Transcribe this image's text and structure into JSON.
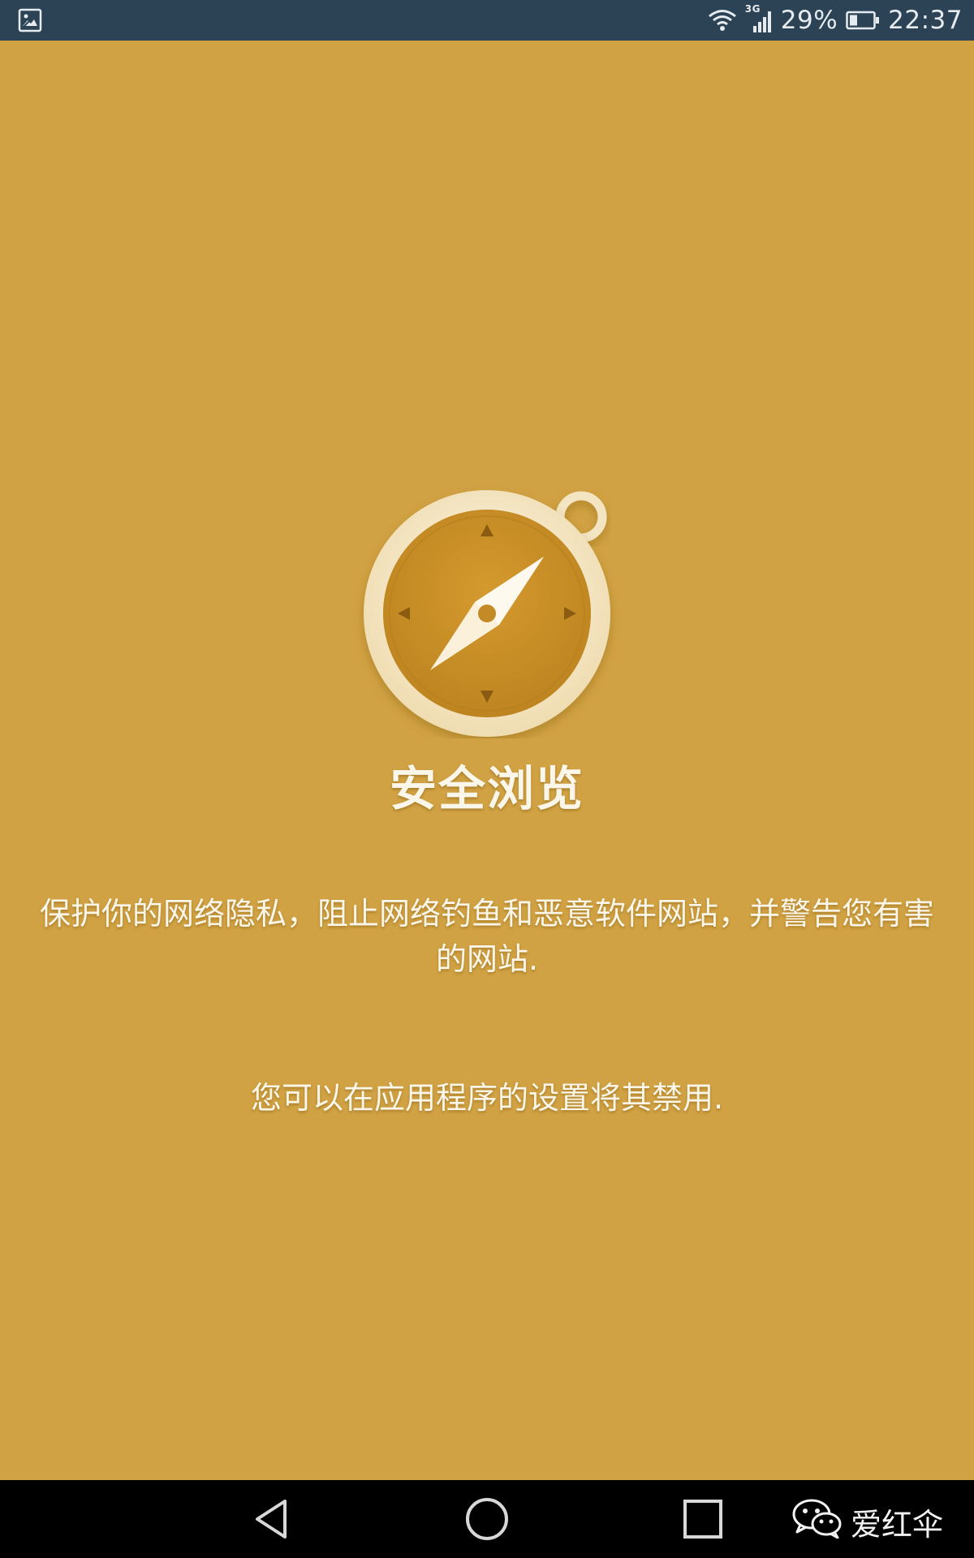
{
  "status_bar": {
    "left_icon": "image-icon",
    "network_type": "3G",
    "battery_percent": "29%",
    "time": "22:37"
  },
  "main": {
    "icon": "compass-icon",
    "title": "安全浏览",
    "description": "保护你的网络隐私，阻止网络钓鱼和恶意软件网站，并警告您有害的网站.",
    "disable_note": "您可以在应用程序的设置将其禁用."
  },
  "nav_bar": {
    "buttons": [
      "back-icon",
      "home-icon",
      "recents-icon"
    ]
  },
  "watermark": {
    "icon": "wechat-icon",
    "text": "爱红伞"
  },
  "colors": {
    "background": "#d1a243",
    "status_bar": "#2c4355",
    "nav_bar": "#000000",
    "text": "#fbf6ea"
  }
}
